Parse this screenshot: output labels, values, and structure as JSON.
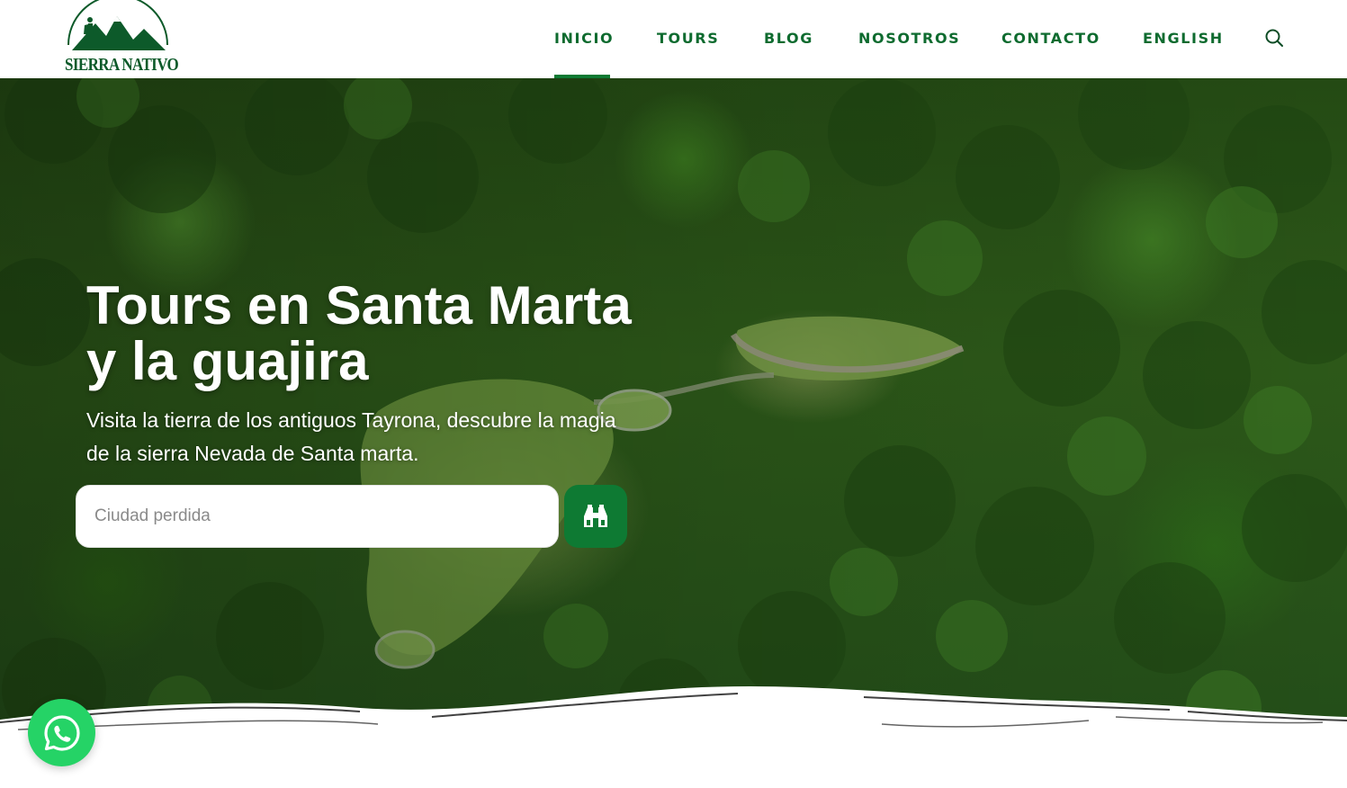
{
  "brand": {
    "logo_text": "SIERRA NATIVO",
    "icon": "mountain-hiker-logo",
    "color": "#0d5a2a"
  },
  "nav": {
    "items": [
      {
        "label": "INICIO",
        "active": true
      },
      {
        "label": "TOURS",
        "active": false
      },
      {
        "label": "BLOG",
        "active": false
      },
      {
        "label": "NOSOTROS",
        "active": false
      },
      {
        "label": "CONTACTO",
        "active": false
      },
      {
        "label": "ENGLISH",
        "active": false
      }
    ],
    "search_icon": "search-icon",
    "accent": "#0e7a33"
  },
  "hero": {
    "title": "Tours en Santa Marta y la guajira",
    "subtitle": "Visita la tierra de los antiguos Tayrona, descubre la magia de la sierra Nevada de Santa marta.",
    "search": {
      "placeholder": "Ciudad perdida",
      "button_icon": "binoculars-icon"
    }
  },
  "floating": {
    "whatsapp_icon": "whatsapp-icon",
    "color": "#25d366"
  }
}
